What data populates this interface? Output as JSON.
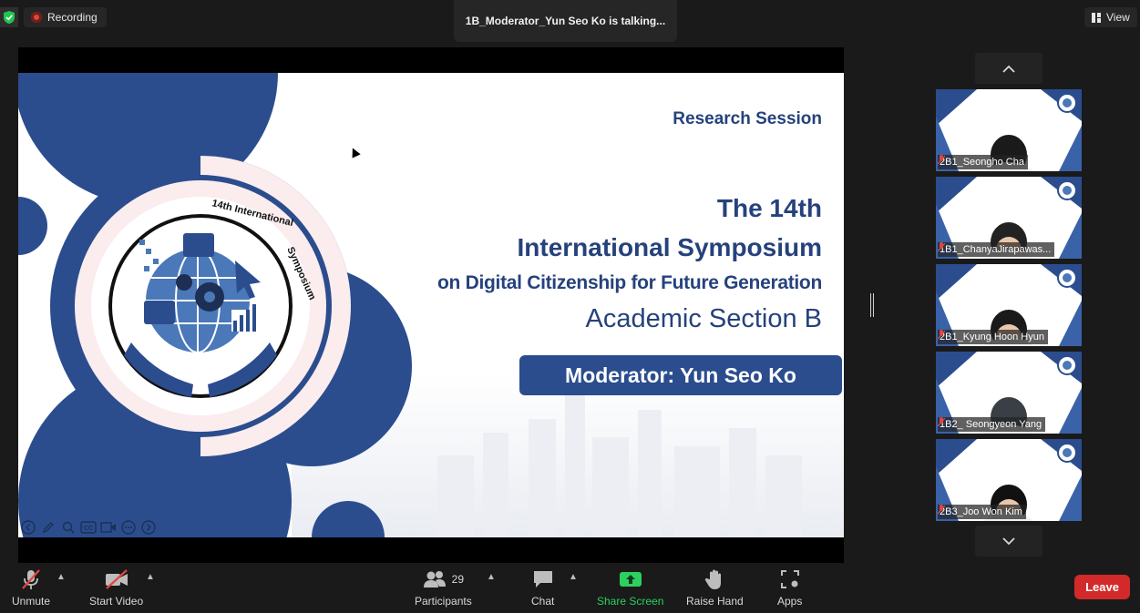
{
  "top": {
    "recording_label": "Recording",
    "talking_label": "1B_Moderator_Yun Seo Ko is talking...",
    "view_label": "View"
  },
  "slide": {
    "research": "Research Session",
    "title_line1": "The 14th",
    "title_line2": "International Symposium",
    "title_line3": "on Digital Citizenship for Future Generation",
    "section": "Academic Section B",
    "moderator": "Moderator: Yun Seo Ko",
    "logo_ring_text": "14th International Symposium",
    "brand_color": "#2b4d8e"
  },
  "participants": [
    {
      "name": "2B1_Seongho Cha"
    },
    {
      "name": "1B1_ChanyaJirapawas..."
    },
    {
      "name": "2B1_Kyung Hoon Hyun"
    },
    {
      "name": "1B2_ Seongyeon Yang"
    },
    {
      "name": "2B3_Joo Won Kim"
    }
  ],
  "toolbar": {
    "unmute": "Unmute",
    "start_video": "Start Video",
    "participants": "Participants",
    "participants_count": "29",
    "chat": "Chat",
    "share_screen": "Share Screen",
    "raise_hand": "Raise Hand",
    "apps": "Apps",
    "leave": "Leave"
  },
  "colors": {
    "leave": "#d22a2a",
    "share_green": "#2dd05f",
    "recording_dot": "#e0463d"
  }
}
